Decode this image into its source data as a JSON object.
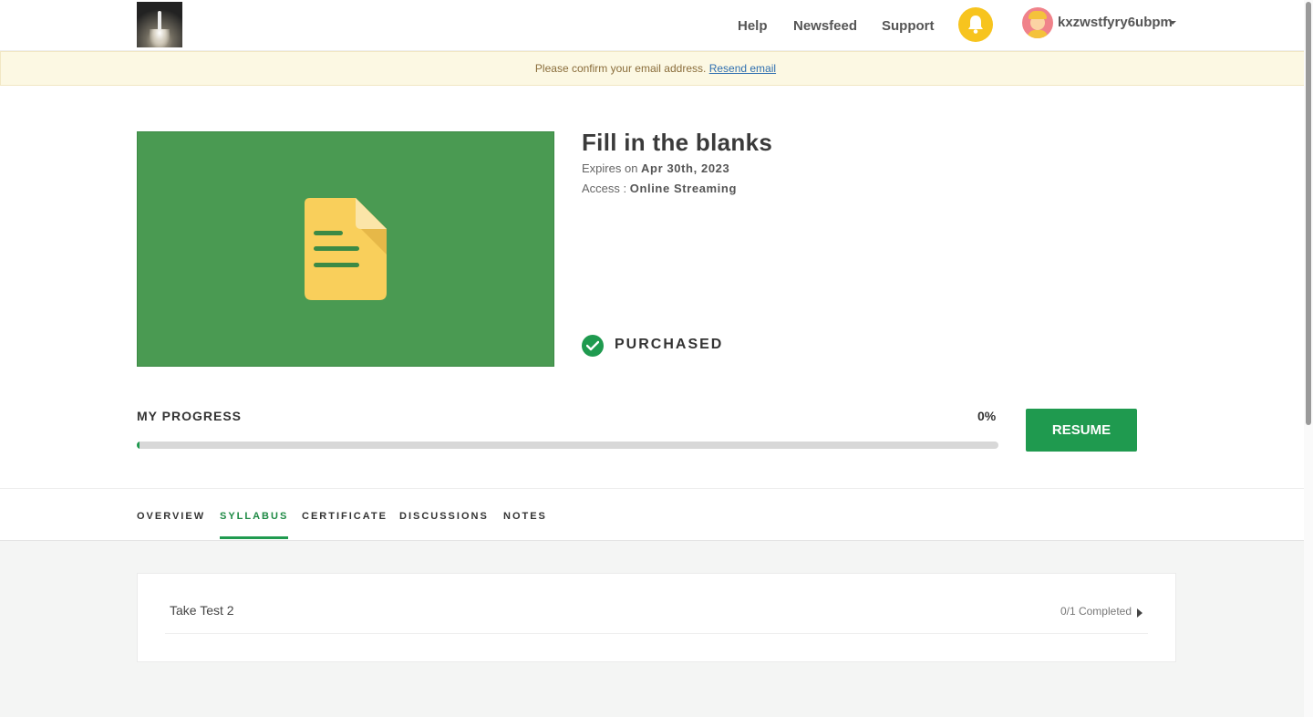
{
  "header": {
    "nav": [
      "Help",
      "Newsfeed",
      "Support"
    ],
    "username": "kxzwstfyry6ubpm"
  },
  "banner": {
    "message": "Please confirm your email address.",
    "link": "Resend email"
  },
  "course": {
    "title": "Fill in the blanks",
    "expires_prefix": "Expires on",
    "expires_date": "Apr 30th, 2023",
    "access_prefix": "Access :",
    "access_value": "Online Streaming",
    "status": "PURCHASED",
    "thumbnail_color": "#4a9a52"
  },
  "progress": {
    "label": "MY PROGRESS",
    "percent_text": "0%",
    "value": 0,
    "resume_label": "RESUME",
    "accent": "#1f9a4f"
  },
  "tabs": [
    {
      "label": "OVERVIEW",
      "active": false
    },
    {
      "label": "SYLLABUS",
      "active": true
    },
    {
      "label": "CERTIFICATE",
      "active": false
    },
    {
      "label": "DISCUSSIONS",
      "active": false
    },
    {
      "label": "NOTES",
      "active": false
    }
  ],
  "syllabus": {
    "items": [
      {
        "title": "Take Test 2",
        "status": "0/1 Completed"
      }
    ]
  }
}
